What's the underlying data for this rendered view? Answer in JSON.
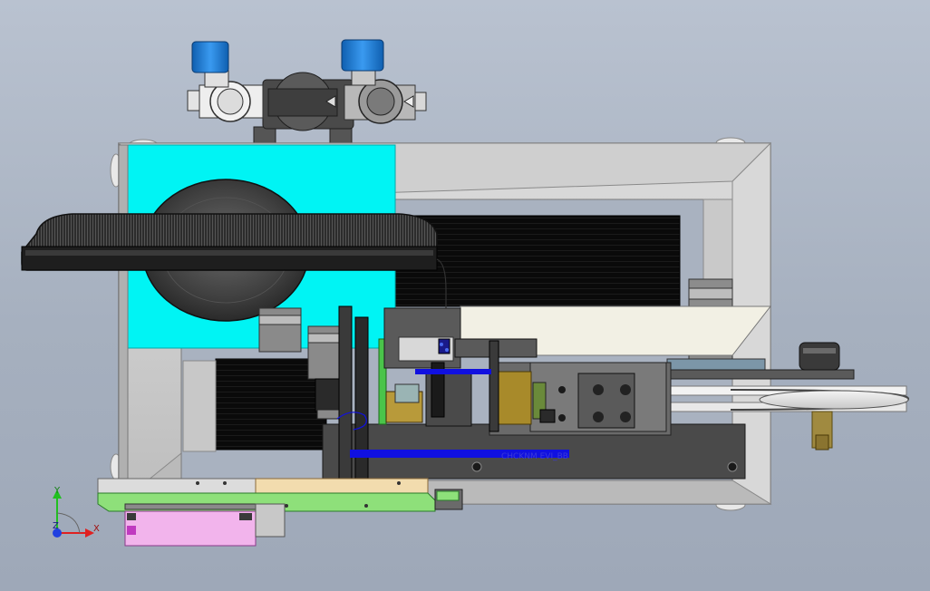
{
  "viewport": {
    "background_top": "#b9c2d0",
    "background_bottom": "#9ea8b8"
  },
  "colors": {
    "cyan_panel": "#00f4f4",
    "frame_gray": "#c9c9c9",
    "frame_dark": "#8a8a8a",
    "dark_metal": "#3c3c3c",
    "black_panel": "#0c0c0c",
    "blue_valve": "#1f7fd8",
    "blue_highlight": "#1010e0",
    "green_plate": "#8ee07a",
    "tan_plate": "#f2dcae",
    "pink_block": "#f2b4ec",
    "gold_block": "#a88a2a",
    "cream_plate": "#f2f0e4",
    "brass": "#a08a40",
    "axis_x": "#e02020",
    "axis_y": "#20c020",
    "axis_z": "#2040e0"
  },
  "annotation": {
    "label": "CHCKNM EVI_BB"
  },
  "triad": {
    "x_label": "X",
    "y_label": "Y",
    "z_label": "Z"
  }
}
